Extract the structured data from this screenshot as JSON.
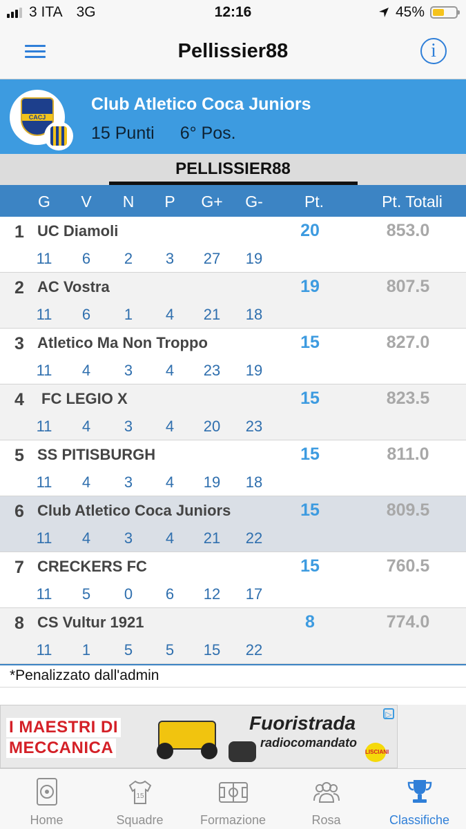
{
  "status_bar": {
    "carrier": "3 ITA",
    "network": "3G",
    "time": "12:16",
    "battery": "45%"
  },
  "nav": {
    "title": "Pellissier88",
    "info_icon": "i"
  },
  "team": {
    "name": "Club Atletico Coca Juniors",
    "points": "15 Punti",
    "position": "6° Pos.",
    "logo_text": "CACJ"
  },
  "tab": {
    "label": "PELLISSIER88"
  },
  "columns": {
    "g": "G",
    "v": "V",
    "n": "N",
    "p": "P",
    "gf": "G+",
    "gs": "G-",
    "pt": "Pt.",
    "tot": "Pt. Totali"
  },
  "rows": [
    {
      "pos": "1",
      "name": "UC Diamoli",
      "g": "11",
      "v": "6",
      "n": "2",
      "p": "3",
      "gf": "27",
      "gs": "19",
      "pt": "20",
      "tot": "853.0"
    },
    {
      "pos": "2",
      "name": "AC Vostra",
      "g": "11",
      "v": "6",
      "n": "1",
      "p": "4",
      "gf": "21",
      "gs": "18",
      "pt": "19",
      "tot": "807.5"
    },
    {
      "pos": "3",
      "name": "Atletico Ma Non Troppo",
      "g": "11",
      "v": "4",
      "n": "3",
      "p": "4",
      "gf": "23",
      "gs": "19",
      "pt": "15",
      "tot": "827.0"
    },
    {
      "pos": "4",
      "name": "FC LEGIO X",
      "g": "11",
      "v": "4",
      "n": "3",
      "p": "4",
      "gf": "20",
      "gs": "23",
      "pt": "15",
      "tot": "823.5"
    },
    {
      "pos": "5",
      "name": "SS PITISBURGH",
      "g": "11",
      "v": "4",
      "n": "3",
      "p": "4",
      "gf": "19",
      "gs": "18",
      "pt": "15",
      "tot": "811.0"
    },
    {
      "pos": "6",
      "name": "Club Atletico Coca Juniors",
      "g": "11",
      "v": "4",
      "n": "3",
      "p": "4",
      "gf": "21",
      "gs": "22",
      "pt": "15",
      "tot": "809.5"
    },
    {
      "pos": "7",
      "name": "CRECKERS FC",
      "g": "11",
      "v": "5",
      "n": "0",
      "p": "6",
      "gf": "12",
      "gs": "17",
      "pt": "15",
      "tot": "760.5"
    },
    {
      "pos": "8",
      "name": "CS Vultur 1921",
      "g": "11",
      "v": "1",
      "n": "5",
      "p": "5",
      "gf": "15",
      "gs": "22",
      "pt": "8",
      "tot": "774.0"
    }
  ],
  "note": "*Penalizzato dall'admin",
  "ad": {
    "line1": "I MAESTRI DI",
    "line2": "MECCANICA",
    "title": "Fuoristrada",
    "subtitle": "radiocomandato",
    "brand": "LISCIANI"
  },
  "tabbar": [
    {
      "label": "Home",
      "icon": "home-ball-icon"
    },
    {
      "label": "Squadre",
      "icon": "jersey-icon"
    },
    {
      "label": "Formazione",
      "icon": "pitch-icon"
    },
    {
      "label": "Rosa",
      "icon": "group-icon"
    },
    {
      "label": "Classifiche",
      "icon": "trophy-icon"
    }
  ],
  "colors": {
    "accent": "#2f7fd8",
    "team_header": "#3d9be0",
    "column_header": "#3c84c4",
    "highlight_row": "#dadfe6"
  }
}
